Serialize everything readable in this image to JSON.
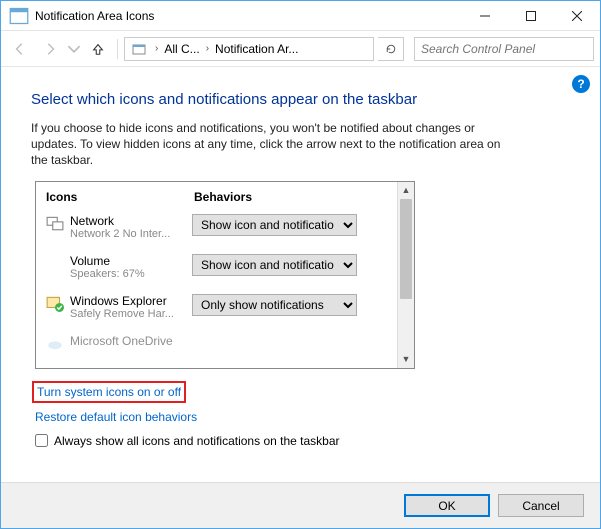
{
  "window": {
    "title": "Notification Area Icons"
  },
  "breadcrumb": {
    "item1": "All C...",
    "item2": "Notification Ar..."
  },
  "search": {
    "placeholder": "Search Control Panel"
  },
  "help": {
    "glyph": "?"
  },
  "heading": "Select which icons and notifications appear on the taskbar",
  "description": "If you choose to hide icons and notifications, you won't be notified about changes or updates. To view hidden icons at any time, click the arrow next to the notification area on the taskbar.",
  "columns": {
    "icons": "Icons",
    "behaviors": "Behaviors"
  },
  "items": [
    {
      "name": "Network",
      "sub": "Network  2 No Inter...",
      "behavior": "Show icon and notificatio"
    },
    {
      "name": "Volume",
      "sub": "Speakers: 67%",
      "behavior": "Show icon and notificatio"
    },
    {
      "name": "Windows Explorer",
      "sub": "Safely Remove Har...",
      "behavior": "Only show notifications"
    },
    {
      "name": "Microsoft OneDrive",
      "sub": "",
      "behavior": ""
    }
  ],
  "links": {
    "system_icons": "Turn system icons on or off",
    "restore": "Restore default icon behaviors"
  },
  "checkbox": {
    "label": "Always show all icons and notifications on the taskbar"
  },
  "footer": {
    "ok": "OK",
    "cancel": "Cancel"
  }
}
